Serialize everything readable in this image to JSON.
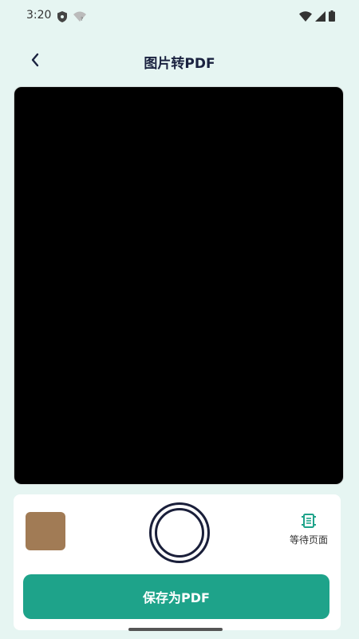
{
  "status_bar": {
    "time": "3:20"
  },
  "header": {
    "title": "图片转PDF",
    "back_icon": "chevron-left-icon"
  },
  "preview": {
    "background": "#000000"
  },
  "bottom_panel": {
    "thumbnail_color": "#a17b55",
    "pending_pages_label": "等待页面",
    "pending_icon": "document-stack-icon",
    "save_label": "保存为PDF",
    "accent": "#1ea38a"
  }
}
